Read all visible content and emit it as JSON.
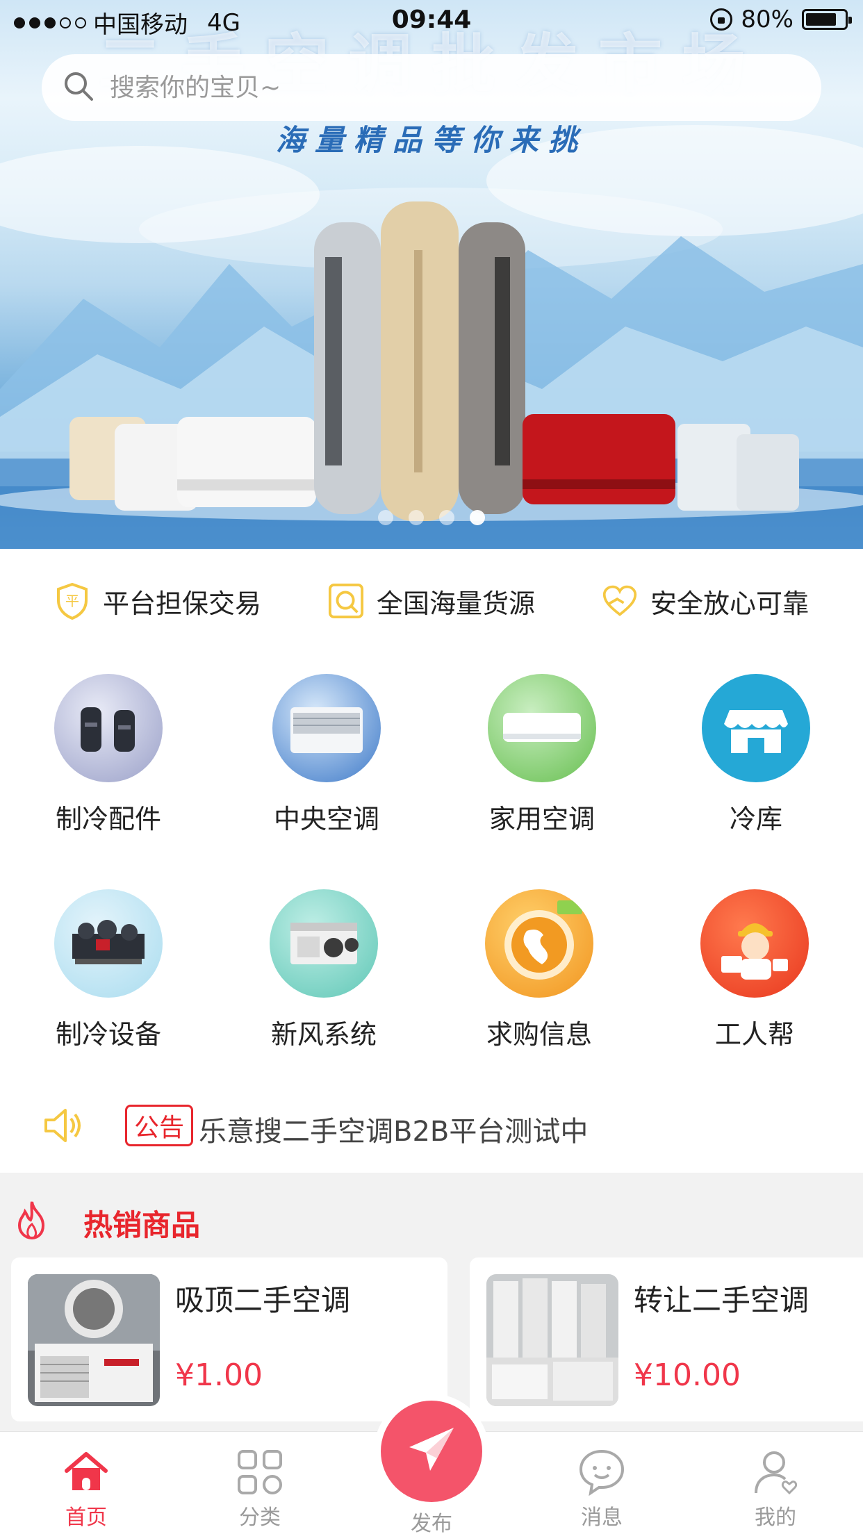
{
  "status_bar": {
    "carrier": "中国移动",
    "network": "4G",
    "time": "09:44",
    "battery": "80%",
    "battery_level": 0.8
  },
  "search": {
    "placeholder": "搜索你的宝贝~"
  },
  "banner": {
    "title": "二手空调批发市场",
    "subtitle": "海量精品等你来挑",
    "slide_count": 4,
    "active_slide": 4
  },
  "guarantees": [
    {
      "icon": "shield-icon",
      "label": "平台担保交易"
    },
    {
      "icon": "magnifier-icon",
      "label": "全国海量货源"
    },
    {
      "icon": "heart-hand-icon",
      "label": "安全放心可靠"
    }
  ],
  "categories": [
    {
      "icon": "compressor-icon",
      "label": "制冷配件"
    },
    {
      "icon": "central-ac-icon",
      "label": "中央空调"
    },
    {
      "icon": "home-ac-icon",
      "label": "家用空调"
    },
    {
      "icon": "storefront-icon",
      "label": "冷库"
    },
    {
      "icon": "chiller-icon",
      "label": "制冷设备"
    },
    {
      "icon": "ventilation-icon",
      "label": "新风系统"
    },
    {
      "icon": "globe-icon",
      "label": "求购信息"
    },
    {
      "icon": "worker-icon",
      "label": "工人帮"
    }
  ],
  "notice": {
    "tag": "公告",
    "text": "乐意搜二手空调B2B平台测试中"
  },
  "hot": {
    "title": "热销商品",
    "products": [
      {
        "name": "吸顶二手空调",
        "price": "¥1.00"
      },
      {
        "name": "转让二手空调",
        "price": "¥10.00"
      }
    ]
  },
  "tabbar": {
    "home": "首页",
    "category": "分类",
    "publish": "发布",
    "messages": "消息",
    "mine": "我的"
  },
  "colors": {
    "accent": "#f0364a",
    "notice_red": "#e8262d",
    "guarantee_yellow": "#f5c842"
  }
}
